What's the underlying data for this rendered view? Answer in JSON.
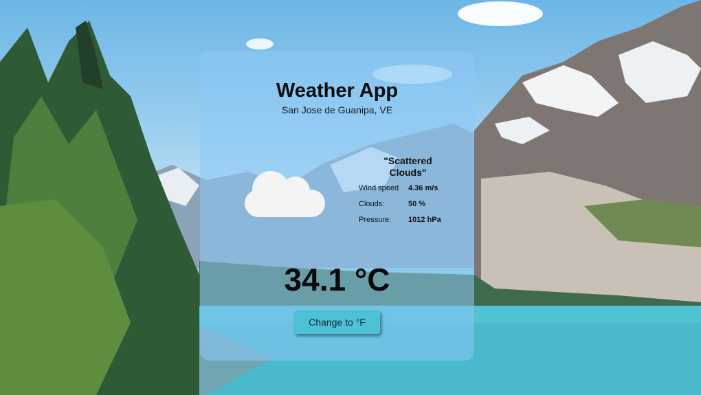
{
  "app": {
    "title": "Weather App",
    "location": "San Jose de Guanipa, VE"
  },
  "weather": {
    "description": "\"Scattered Clouds\"",
    "icon": "cloud-icon",
    "temperature": "34.1 °C",
    "details": [
      {
        "label": "Wind speed",
        "value": "4.36 m/s"
      },
      {
        "label": "Clouds:",
        "value": "50 %"
      },
      {
        "label": "Pressure:",
        "value": "1012 hPa"
      }
    ]
  },
  "controls": {
    "unit_toggle_label": "Change to °F"
  },
  "colors": {
    "card_tint": "#8cc8f5",
    "button": "#4ec1d6"
  }
}
